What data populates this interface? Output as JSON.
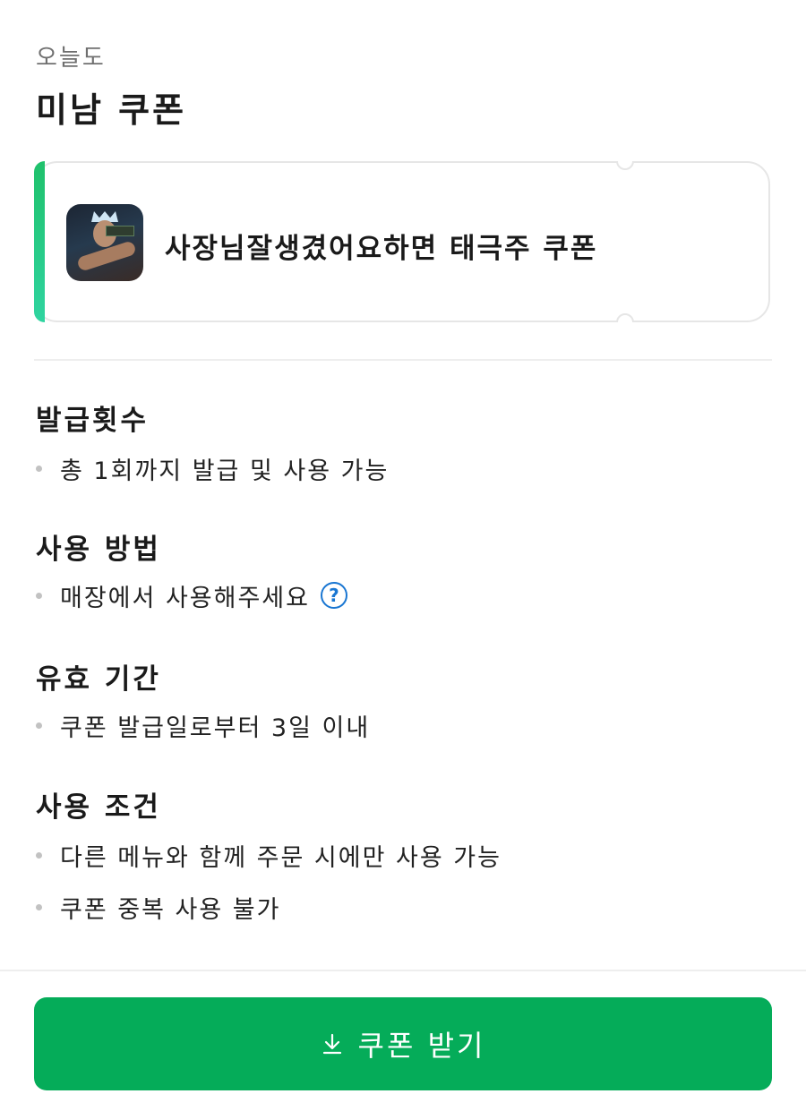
{
  "header": {
    "subtitle": "오늘도",
    "title": "미남 쿠폰"
  },
  "coupon": {
    "name": "사장님잘생겼어요하면 태극주 쿠폰",
    "thumbnail_icon": "store-photo",
    "accent_color": "#1fc16b"
  },
  "sections": [
    {
      "heading": "발급횟수",
      "items": [
        "총 1회까지 발급 및 사용 가능"
      ]
    },
    {
      "heading": "사용 방법",
      "items": [
        "매장에서 사용해주세요"
      ],
      "help_icon": "question-circle-icon"
    },
    {
      "heading": "유효 기간",
      "items": [
        "쿠폰 발급일로부터 3일 이내"
      ]
    },
    {
      "heading": "사용 조건",
      "items": [
        "다른 메뉴와 함께 주문 시에만 사용 가능",
        "쿠폰 중복 사용 불가"
      ]
    }
  ],
  "button": {
    "label": "쿠폰 받기",
    "icon": "download-icon",
    "color": "#05ac59"
  }
}
